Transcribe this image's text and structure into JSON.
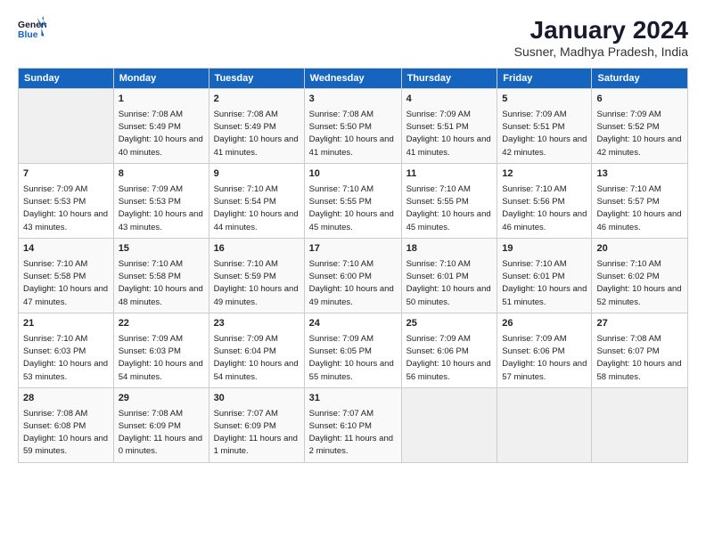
{
  "logo": {
    "line1": "General",
    "line2": "Blue"
  },
  "title": "January 2024",
  "subtitle": "Susner, Madhya Pradesh, India",
  "headers": [
    "Sunday",
    "Monday",
    "Tuesday",
    "Wednesday",
    "Thursday",
    "Friday",
    "Saturday"
  ],
  "weeks": [
    [
      {
        "day": "",
        "sunrise": "",
        "sunset": "",
        "daylight": ""
      },
      {
        "day": "1",
        "sunrise": "Sunrise: 7:08 AM",
        "sunset": "Sunset: 5:49 PM",
        "daylight": "Daylight: 10 hours and 40 minutes."
      },
      {
        "day": "2",
        "sunrise": "Sunrise: 7:08 AM",
        "sunset": "Sunset: 5:49 PM",
        "daylight": "Daylight: 10 hours and 41 minutes."
      },
      {
        "day": "3",
        "sunrise": "Sunrise: 7:08 AM",
        "sunset": "Sunset: 5:50 PM",
        "daylight": "Daylight: 10 hours and 41 minutes."
      },
      {
        "day": "4",
        "sunrise": "Sunrise: 7:09 AM",
        "sunset": "Sunset: 5:51 PM",
        "daylight": "Daylight: 10 hours and 41 minutes."
      },
      {
        "day": "5",
        "sunrise": "Sunrise: 7:09 AM",
        "sunset": "Sunset: 5:51 PM",
        "daylight": "Daylight: 10 hours and 42 minutes."
      },
      {
        "day": "6",
        "sunrise": "Sunrise: 7:09 AM",
        "sunset": "Sunset: 5:52 PM",
        "daylight": "Daylight: 10 hours and 42 minutes."
      }
    ],
    [
      {
        "day": "7",
        "sunrise": "Sunrise: 7:09 AM",
        "sunset": "Sunset: 5:53 PM",
        "daylight": "Daylight: 10 hours and 43 minutes."
      },
      {
        "day": "8",
        "sunrise": "Sunrise: 7:09 AM",
        "sunset": "Sunset: 5:53 PM",
        "daylight": "Daylight: 10 hours and 43 minutes."
      },
      {
        "day": "9",
        "sunrise": "Sunrise: 7:10 AM",
        "sunset": "Sunset: 5:54 PM",
        "daylight": "Daylight: 10 hours and 44 minutes."
      },
      {
        "day": "10",
        "sunrise": "Sunrise: 7:10 AM",
        "sunset": "Sunset: 5:55 PM",
        "daylight": "Daylight: 10 hours and 45 minutes."
      },
      {
        "day": "11",
        "sunrise": "Sunrise: 7:10 AM",
        "sunset": "Sunset: 5:55 PM",
        "daylight": "Daylight: 10 hours and 45 minutes."
      },
      {
        "day": "12",
        "sunrise": "Sunrise: 7:10 AM",
        "sunset": "Sunset: 5:56 PM",
        "daylight": "Daylight: 10 hours and 46 minutes."
      },
      {
        "day": "13",
        "sunrise": "Sunrise: 7:10 AM",
        "sunset": "Sunset: 5:57 PM",
        "daylight": "Daylight: 10 hours and 46 minutes."
      }
    ],
    [
      {
        "day": "14",
        "sunrise": "Sunrise: 7:10 AM",
        "sunset": "Sunset: 5:58 PM",
        "daylight": "Daylight: 10 hours and 47 minutes."
      },
      {
        "day": "15",
        "sunrise": "Sunrise: 7:10 AM",
        "sunset": "Sunset: 5:58 PM",
        "daylight": "Daylight: 10 hours and 48 minutes."
      },
      {
        "day": "16",
        "sunrise": "Sunrise: 7:10 AM",
        "sunset": "Sunset: 5:59 PM",
        "daylight": "Daylight: 10 hours and 49 minutes."
      },
      {
        "day": "17",
        "sunrise": "Sunrise: 7:10 AM",
        "sunset": "Sunset: 6:00 PM",
        "daylight": "Daylight: 10 hours and 49 minutes."
      },
      {
        "day": "18",
        "sunrise": "Sunrise: 7:10 AM",
        "sunset": "Sunset: 6:01 PM",
        "daylight": "Daylight: 10 hours and 50 minutes."
      },
      {
        "day": "19",
        "sunrise": "Sunrise: 7:10 AM",
        "sunset": "Sunset: 6:01 PM",
        "daylight": "Daylight: 10 hours and 51 minutes."
      },
      {
        "day": "20",
        "sunrise": "Sunrise: 7:10 AM",
        "sunset": "Sunset: 6:02 PM",
        "daylight": "Daylight: 10 hours and 52 minutes."
      }
    ],
    [
      {
        "day": "21",
        "sunrise": "Sunrise: 7:10 AM",
        "sunset": "Sunset: 6:03 PM",
        "daylight": "Daylight: 10 hours and 53 minutes."
      },
      {
        "day": "22",
        "sunrise": "Sunrise: 7:09 AM",
        "sunset": "Sunset: 6:03 PM",
        "daylight": "Daylight: 10 hours and 54 minutes."
      },
      {
        "day": "23",
        "sunrise": "Sunrise: 7:09 AM",
        "sunset": "Sunset: 6:04 PM",
        "daylight": "Daylight: 10 hours and 54 minutes."
      },
      {
        "day": "24",
        "sunrise": "Sunrise: 7:09 AM",
        "sunset": "Sunset: 6:05 PM",
        "daylight": "Daylight: 10 hours and 55 minutes."
      },
      {
        "day": "25",
        "sunrise": "Sunrise: 7:09 AM",
        "sunset": "Sunset: 6:06 PM",
        "daylight": "Daylight: 10 hours and 56 minutes."
      },
      {
        "day": "26",
        "sunrise": "Sunrise: 7:09 AM",
        "sunset": "Sunset: 6:06 PM",
        "daylight": "Daylight: 10 hours and 57 minutes."
      },
      {
        "day": "27",
        "sunrise": "Sunrise: 7:08 AM",
        "sunset": "Sunset: 6:07 PM",
        "daylight": "Daylight: 10 hours and 58 minutes."
      }
    ],
    [
      {
        "day": "28",
        "sunrise": "Sunrise: 7:08 AM",
        "sunset": "Sunset: 6:08 PM",
        "daylight": "Daylight: 10 hours and 59 minutes."
      },
      {
        "day": "29",
        "sunrise": "Sunrise: 7:08 AM",
        "sunset": "Sunset: 6:09 PM",
        "daylight": "Daylight: 11 hours and 0 minutes."
      },
      {
        "day": "30",
        "sunrise": "Sunrise: 7:07 AM",
        "sunset": "Sunset: 6:09 PM",
        "daylight": "Daylight: 11 hours and 1 minute."
      },
      {
        "day": "31",
        "sunrise": "Sunrise: 7:07 AM",
        "sunset": "Sunset: 6:10 PM",
        "daylight": "Daylight: 11 hours and 2 minutes."
      },
      {
        "day": "",
        "sunrise": "",
        "sunset": "",
        "daylight": ""
      },
      {
        "day": "",
        "sunrise": "",
        "sunset": "",
        "daylight": ""
      },
      {
        "day": "",
        "sunrise": "",
        "sunset": "",
        "daylight": ""
      }
    ]
  ]
}
